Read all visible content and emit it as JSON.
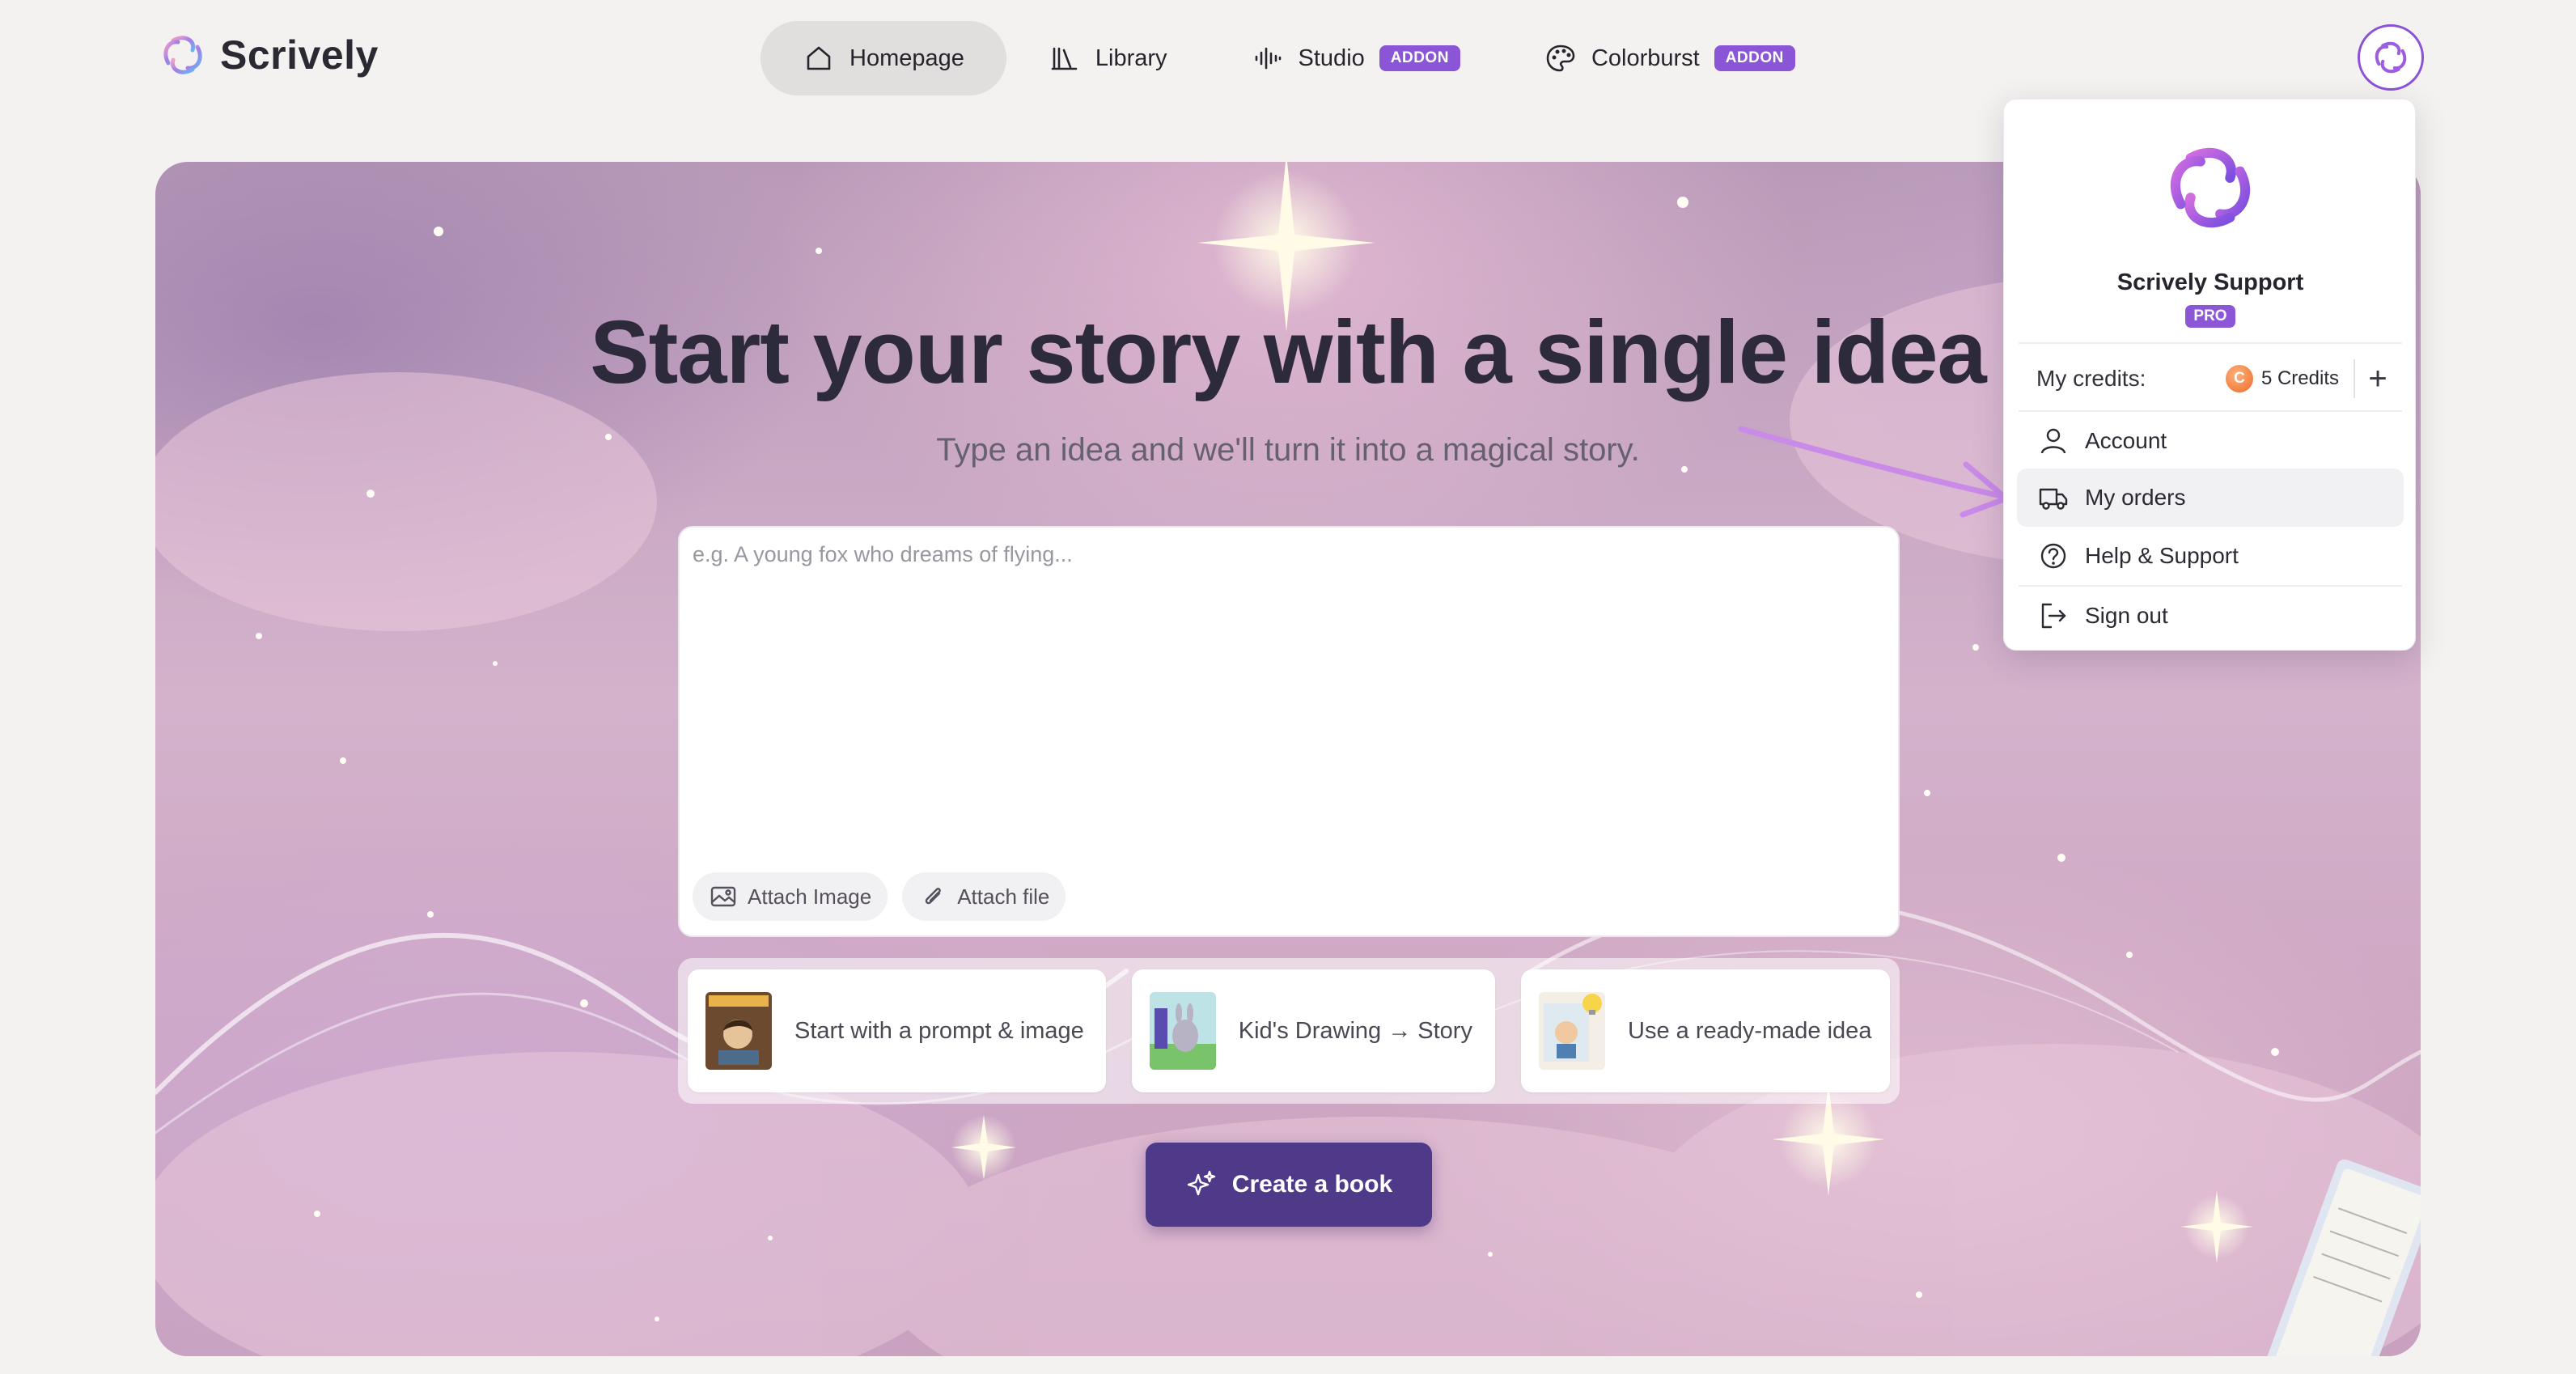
{
  "app": {
    "name": "Scrively"
  },
  "nav": {
    "items": [
      {
        "label": "Homepage",
        "icon": "home-icon",
        "active": true
      },
      {
        "label": "Library",
        "icon": "library-icon",
        "active": false
      },
      {
        "label": "Studio",
        "icon": "waveform-icon",
        "badge": "ADDON",
        "active": false
      },
      {
        "label": "Colorburst",
        "icon": "palette-icon",
        "badge": "ADDON",
        "active": false
      }
    ]
  },
  "hero": {
    "title": "Start your story with a single idea",
    "subtitle": "Type an idea and we'll turn it into a magical story.",
    "prompt_placeholder": "e.g. A young fox who dreams of flying...",
    "prompt_value": "",
    "attach_image_label": "Attach Image",
    "attach_file_label": "Attach file",
    "starters": [
      {
        "label": "Start with a prompt & image"
      },
      {
        "label": "Kid's Drawing → Story"
      },
      {
        "label": "Use a ready-made idea"
      }
    ],
    "create_button_label": "Create a book"
  },
  "user_menu": {
    "name": "Scrively Support",
    "plan_badge": "PRO",
    "credits_label": "My credits:",
    "credits_value": "5 Credits",
    "credits_coin_letter": "C",
    "items": [
      {
        "label": "Account",
        "icon": "user-icon"
      },
      {
        "label": "My orders",
        "icon": "truck-icon",
        "highlighted": true
      },
      {
        "label": "Help & Support",
        "icon": "help-icon"
      },
      {
        "label": "Sign out",
        "icon": "sign-out-icon"
      }
    ]
  },
  "colors": {
    "accent": "#8b52d8",
    "primary_button": "#4f3a8a",
    "page_background": "#f4f2f0",
    "annotation_arrow": "#c98ae8"
  }
}
